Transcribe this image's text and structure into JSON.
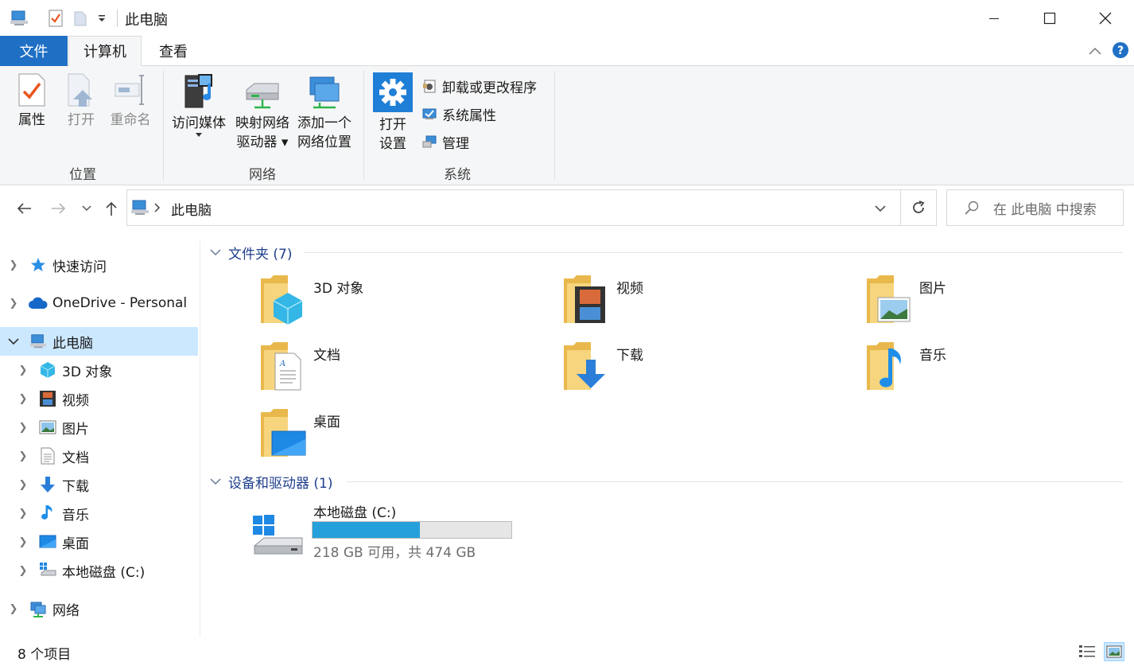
{
  "window": {
    "title": "此电脑",
    "minimize_icon": "minimize-icon",
    "maximize_icon": "maximize-icon",
    "close_icon": "close-icon"
  },
  "ribbon_tabs": {
    "file": "文件",
    "computer": "计算机",
    "view": "查看"
  },
  "ribbon": {
    "groups": {
      "location": "位置",
      "network": "网络",
      "system": "系统"
    },
    "properties": "属性",
    "open": "打开",
    "rename": "重命名",
    "access_media": "访问媒体",
    "map_drive_l1": "映射网络",
    "map_drive_l2": "驱动器",
    "add_location_l1": "添加一个",
    "add_location_l2": "网络位置",
    "open_settings_l1": "打开",
    "open_settings_l2": "设置",
    "uninstall": "卸载或更改程序",
    "system_properties": "系统属性",
    "manage": "管理"
  },
  "address": {
    "path": "此电脑",
    "search_placeholder": "在 此电脑 中搜索"
  },
  "sidebar": {
    "quick_access": "快速访问",
    "onedrive": "OneDrive - Personal",
    "this_pc": "此电脑",
    "objects3d": "3D 对象",
    "videos": "视频",
    "pictures": "图片",
    "documents": "文档",
    "downloads": "下载",
    "music": "音乐",
    "desktop": "桌面",
    "local_disk": "本地磁盘 (C:)",
    "network": "网络"
  },
  "content": {
    "folders_header": "文件夹 (7)",
    "devices_header": "设备和驱动器 (1)",
    "folders": {
      "objects3d": "3D 对象",
      "videos": "视频",
      "pictures": "图片",
      "documents": "文档",
      "downloads": "下载",
      "music": "音乐",
      "desktop": "桌面"
    },
    "drive": {
      "name": "本地磁盘 (C:)",
      "free_text": "218 GB 可用，共 474 GB",
      "used_fraction": 0.54
    }
  },
  "status": {
    "item_count": "8 个项目"
  },
  "colors": {
    "accent": "#1f6fc5",
    "selection": "#cce8ff",
    "drive_fill": "#26a0da",
    "section_header": "#1e3e8c"
  }
}
